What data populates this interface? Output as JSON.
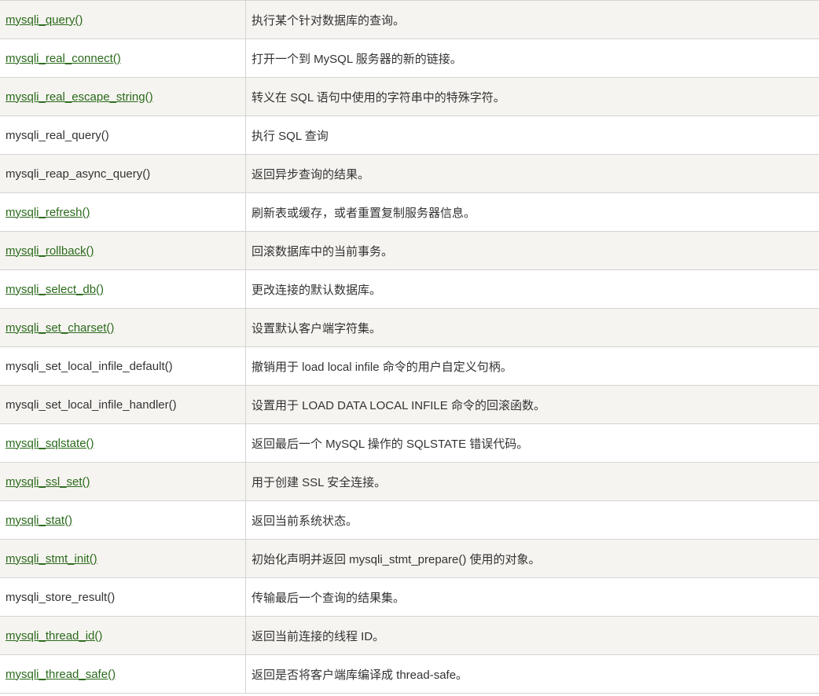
{
  "rows": [
    {
      "func": "mysqli_query()",
      "desc": "执行某个针对数据库的查询。",
      "link": true
    },
    {
      "func": "mysqli_real_connect()",
      "desc": "打开一个到 MySQL 服务器的新的链接。",
      "link": true
    },
    {
      "func": "mysqli_real_escape_string()",
      "desc": "转义在 SQL 语句中使用的字符串中的特殊字符。",
      "link": true
    },
    {
      "func": "mysqli_real_query()",
      "desc": "执行 SQL 查询",
      "link": false
    },
    {
      "func": "mysqli_reap_async_query()",
      "desc": "返回异步查询的结果。",
      "link": false
    },
    {
      "func": "mysqli_refresh()",
      "desc": "刷新表或缓存，或者重置复制服务器信息。",
      "link": true
    },
    {
      "func": "mysqli_rollback()",
      "desc": "回滚数据库中的当前事务。",
      "link": true
    },
    {
      "func": "mysqli_select_db()",
      "desc": "更改连接的默认数据库。",
      "link": true
    },
    {
      "func": "mysqli_set_charset()",
      "desc": "设置默认客户端字符集。",
      "link": true
    },
    {
      "func": "mysqli_set_local_infile_default()",
      "desc": "撤销用于 load local infile 命令的用户自定义句柄。",
      "link": false
    },
    {
      "func": "mysqli_set_local_infile_handler()",
      "desc": "设置用于 LOAD DATA LOCAL INFILE 命令的回滚函数。",
      "link": false
    },
    {
      "func": "mysqli_sqlstate()",
      "desc": "返回最后一个 MySQL 操作的 SQLSTATE 错误代码。",
      "link": true
    },
    {
      "func": "mysqli_ssl_set()",
      "desc": "用于创建 SSL 安全连接。",
      "link": true
    },
    {
      "func": "mysqli_stat()",
      "desc": "返回当前系统状态。",
      "link": true
    },
    {
      "func": "mysqli_stmt_init()",
      "desc": "初始化声明并返回 mysqli_stmt_prepare() 使用的对象。",
      "link": true
    },
    {
      "func": "mysqli_store_result()",
      "desc": "传输最后一个查询的结果集。",
      "link": false
    },
    {
      "func": "mysqli_thread_id()",
      "desc": "返回当前连接的线程 ID。",
      "link": true
    },
    {
      "func": "mysqli_thread_safe()",
      "desc": "返回是否将客户端库编译成 thread-safe。",
      "link": true
    }
  ],
  "colors": {
    "link": "#2a6a1c",
    "text": "#333333",
    "row_shaded": "#f6f4f0",
    "row_plain": "#ffffff",
    "border": "#d4d4d4"
  }
}
